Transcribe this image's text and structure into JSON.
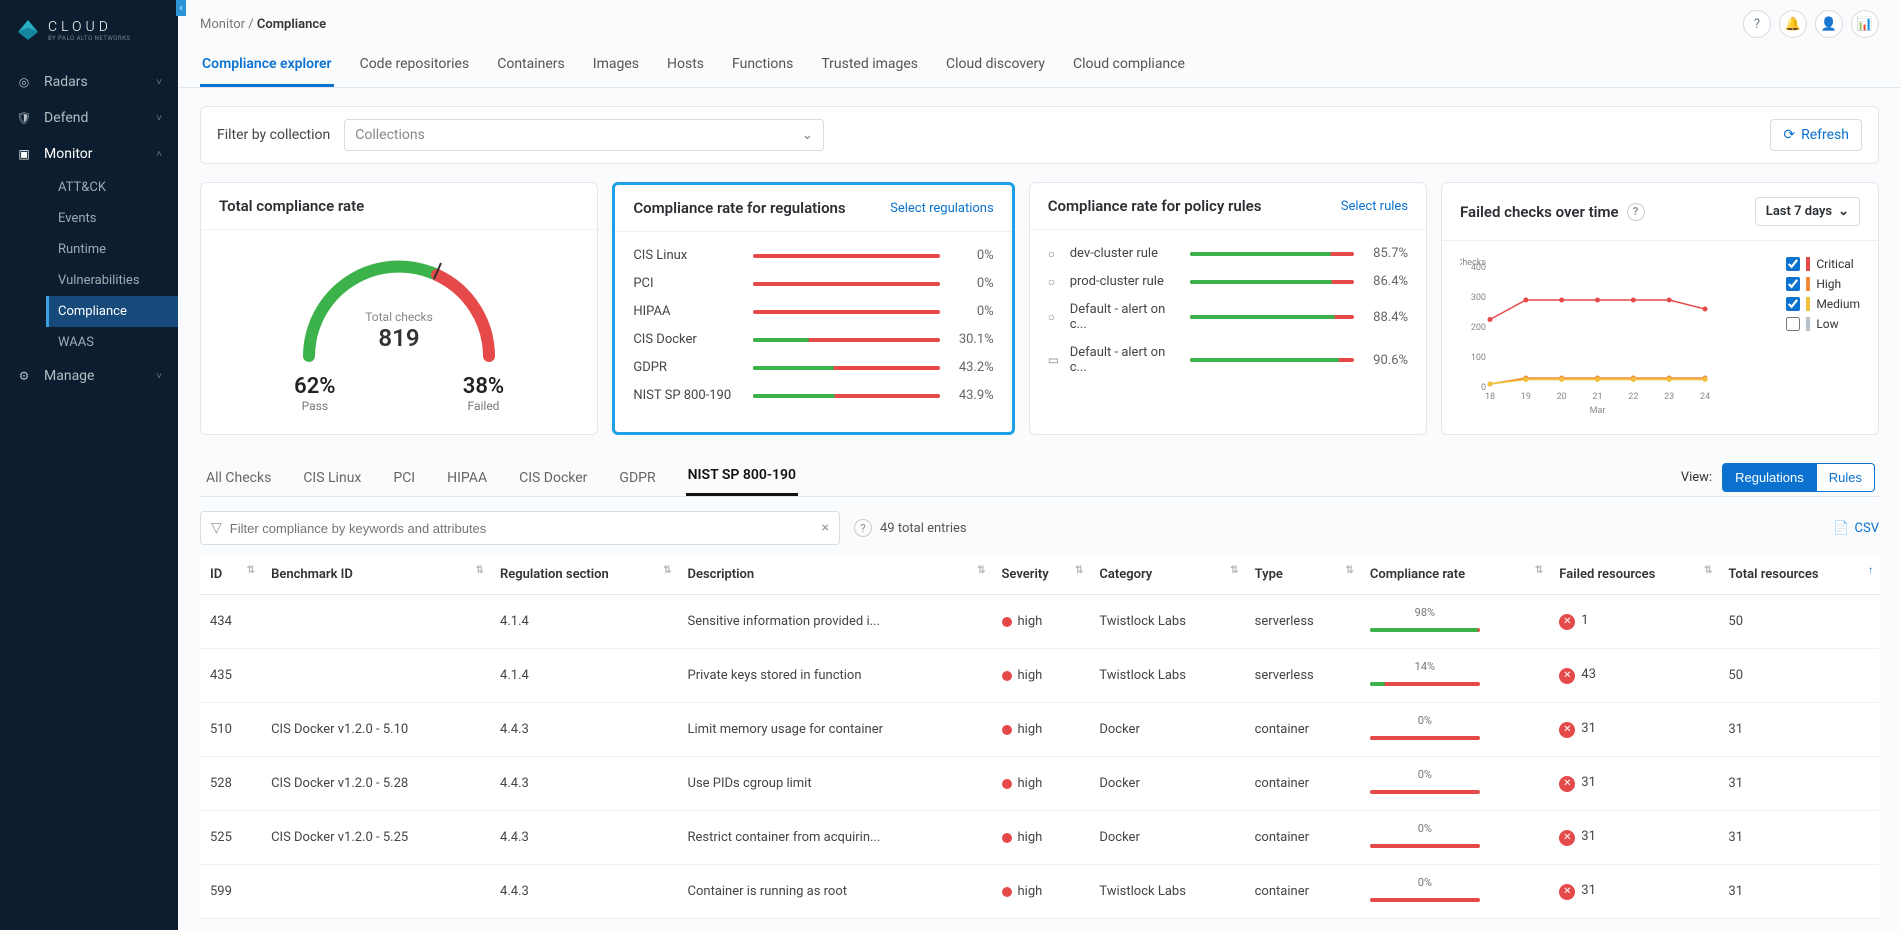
{
  "brand": {
    "title": "CLOUD",
    "subtitle": "BY PALO ALTO NETWORKS"
  },
  "sidebar": {
    "items": [
      {
        "label": "Radars",
        "icon": "radar"
      },
      {
        "label": "Defend",
        "icon": "shield"
      },
      {
        "label": "Monitor",
        "icon": "monitor",
        "active": true,
        "children": [
          {
            "label": "ATT&CK"
          },
          {
            "label": "Events"
          },
          {
            "label": "Runtime"
          },
          {
            "label": "Vulnerabilities"
          },
          {
            "label": "Compliance",
            "active": true
          },
          {
            "label": "WAAS"
          }
        ]
      },
      {
        "label": "Manage",
        "icon": "gear"
      }
    ]
  },
  "breadcrumb": {
    "parent": "Monitor",
    "current": "Compliance"
  },
  "tabs": [
    {
      "label": "Compliance explorer",
      "active": true
    },
    {
      "label": "Code repositories"
    },
    {
      "label": "Containers"
    },
    {
      "label": "Images"
    },
    {
      "label": "Hosts"
    },
    {
      "label": "Functions"
    },
    {
      "label": "Trusted images"
    },
    {
      "label": "Cloud discovery"
    },
    {
      "label": "Cloud compliance"
    }
  ],
  "filter_label": "Filter by collection",
  "collections_placeholder": "Collections",
  "refresh_label": "Refresh",
  "cards": {
    "total": {
      "title": "Total compliance rate",
      "checks_label": "Total checks",
      "checks_value": "819",
      "pass_pct": "62%",
      "pass_label": "Pass",
      "fail_pct": "38%",
      "fail_label": "Failed"
    },
    "regs": {
      "title": "Compliance rate for regulations",
      "link": "Select regulations",
      "rows": [
        {
          "label": "CIS Linux",
          "pct": "0%",
          "fill": 0
        },
        {
          "label": "PCI",
          "pct": "0%",
          "fill": 0
        },
        {
          "label": "HIPAA",
          "pct": "0%",
          "fill": 0
        },
        {
          "label": "CIS Docker",
          "pct": "30.1%",
          "fill": 30.1
        },
        {
          "label": "GDPR",
          "pct": "43.2%",
          "fill": 43.2
        },
        {
          "label": "NIST SP 800-190",
          "pct": "43.9%",
          "fill": 43.9
        }
      ]
    },
    "rules": {
      "title": "Compliance rate for policy rules",
      "link": "Select rules",
      "rows": [
        {
          "label": "dev-cluster rule",
          "pct": "85.7%",
          "fill": 85.7,
          "icon": "○"
        },
        {
          "label": "prod-cluster rule",
          "pct": "86.4%",
          "fill": 86.4,
          "icon": "○"
        },
        {
          "label": "Default - alert on c...",
          "pct": "88.4%",
          "fill": 88.4,
          "icon": "○"
        },
        {
          "label": "Default - alert on c...",
          "pct": "90.6%",
          "fill": 90.6,
          "icon": "▭"
        }
      ]
    },
    "failed": {
      "title": "Failed checks over time",
      "range": "Last 7 days",
      "ylabel": "Checks",
      "legend": [
        {
          "label": "Critical",
          "color": "#e64949",
          "checked": true
        },
        {
          "label": "High",
          "color": "#f08b3b",
          "checked": true
        },
        {
          "label": "Medium",
          "color": "#f0c23b",
          "checked": true
        },
        {
          "label": "Low",
          "color": "#b8c0c8",
          "checked": false
        }
      ]
    }
  },
  "chart_data": {
    "type": "line",
    "xlabel": "Mar",
    "ylabel": "Checks",
    "ylim": [
      0,
      400
    ],
    "yticks": [
      0,
      100,
      200,
      300,
      400
    ],
    "categories": [
      "18",
      "19",
      "20",
      "21",
      "22",
      "23",
      "24"
    ],
    "series": [
      {
        "name": "Critical",
        "color": "#e64949",
        "values": [
          225,
          290,
          290,
          290,
          290,
          290,
          260
        ]
      },
      {
        "name": "High",
        "color": "#f08b3b",
        "values": [
          10,
          30,
          30,
          30,
          30,
          30,
          30
        ]
      },
      {
        "name": "Medium",
        "color": "#f0c23b",
        "values": [
          10,
          25,
          25,
          25,
          25,
          25,
          25
        ]
      }
    ]
  },
  "subtabs": [
    {
      "label": "All Checks"
    },
    {
      "label": "CIS Linux"
    },
    {
      "label": "PCI"
    },
    {
      "label": "HIPAA"
    },
    {
      "label": "CIS Docker"
    },
    {
      "label": "GDPR"
    },
    {
      "label": "NIST SP 800-190",
      "active": true
    }
  ],
  "view": {
    "label": "View:",
    "regulations": "Regulations",
    "rules": "Rules"
  },
  "filter_placeholder": "Filter compliance by keywords and attributes",
  "entries_label": "49 total entries",
  "csv_label": "CSV",
  "columns": [
    "ID",
    "Benchmark ID",
    "Regulation section",
    "Description",
    "Severity",
    "Category",
    "Type",
    "Compliance rate",
    "Failed resources",
    "Total resources"
  ],
  "sort_col": "Total resources",
  "rows": [
    {
      "id": "434",
      "bench": "",
      "section": "4.1.4",
      "desc": "Sensitive information provided i...",
      "sev": "high",
      "sev_color": "#e64949",
      "cat": "Twistlock Labs",
      "type": "serverless",
      "comp_pct": "98%",
      "comp_fill": 98,
      "failed": "1",
      "total": "50"
    },
    {
      "id": "435",
      "bench": "",
      "section": "4.1.4",
      "desc": "Private keys stored in function",
      "sev": "high",
      "sev_color": "#e64949",
      "cat": "Twistlock Labs",
      "type": "serverless",
      "comp_pct": "14%",
      "comp_fill": 14,
      "failed": "43",
      "total": "50"
    },
    {
      "id": "510",
      "bench": "CIS Docker v1.2.0 - 5.10",
      "section": "4.4.3",
      "desc": "Limit memory usage for container",
      "sev": "high",
      "sev_color": "#e64949",
      "cat": "Docker",
      "type": "container",
      "comp_pct": "0%",
      "comp_fill": 0,
      "failed": "31",
      "total": "31"
    },
    {
      "id": "528",
      "bench": "CIS Docker v1.2.0 - 5.28",
      "section": "4.4.3",
      "desc": "Use PIDs cgroup limit",
      "sev": "high",
      "sev_color": "#e64949",
      "cat": "Docker",
      "type": "container",
      "comp_pct": "0%",
      "comp_fill": 0,
      "failed": "31",
      "total": "31"
    },
    {
      "id": "525",
      "bench": "CIS Docker v1.2.0 - 5.25",
      "section": "4.4.3",
      "desc": "Restrict container from acquirin...",
      "sev": "high",
      "sev_color": "#e64949",
      "cat": "Docker",
      "type": "container",
      "comp_pct": "0%",
      "comp_fill": 0,
      "failed": "31",
      "total": "31"
    },
    {
      "id": "599",
      "bench": "",
      "section": "4.4.3",
      "desc": "Container is running as root",
      "sev": "high",
      "sev_color": "#e64949",
      "cat": "Twistlock Labs",
      "type": "container",
      "comp_pct": "0%",
      "comp_fill": 0,
      "failed": "31",
      "total": "31"
    }
  ]
}
